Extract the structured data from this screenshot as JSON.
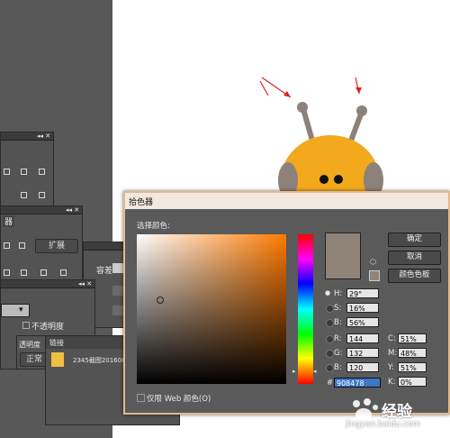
{
  "panels": {
    "upper": {
      "tab_label": "器",
      "button": "扩展"
    },
    "mid": {
      "tolerance_label": "容差",
      "opacity_label": "不透明度",
      "transparency_label": "透明度",
      "mode_value": "正常"
    },
    "links": {
      "tab_label": "链接",
      "item_name": "2345截图2016082"
    }
  },
  "picker": {
    "title": "拾色器",
    "select_label": "选择颜色:",
    "buttons": {
      "ok": "确定",
      "cancel": "取消",
      "swatches": "颜色色板"
    },
    "fields": {
      "H": {
        "label": "H:",
        "value": "29°"
      },
      "S": {
        "label": "S:",
        "value": "16%"
      },
      "B": {
        "label": "B:",
        "value": "56%"
      },
      "R": {
        "label": "R:",
        "value": "144"
      },
      "G": {
        "label": "G:",
        "value": "132"
      },
      "Bl": {
        "label": "B:",
        "value": "120"
      },
      "C": {
        "label": "C:",
        "value": "51%"
      },
      "M": {
        "label": "M:",
        "value": "48%"
      },
      "Y": {
        "label": "Y:",
        "value": "51%"
      },
      "K": {
        "label": "K:",
        "value": "0%"
      },
      "hex": {
        "label": "#",
        "value": "908478"
      }
    },
    "web_only_label": "仅限 Web 颜色(O)",
    "current_color": "#908478"
  },
  "watermark": {
    "text": "经验",
    "site": "jingyan.baidu.com"
  },
  "colors": {
    "accent_border": "#e3b98d",
    "bee_body": "#f2a91c",
    "antenna": "#8c8279",
    "arrow": "#e02020"
  }
}
